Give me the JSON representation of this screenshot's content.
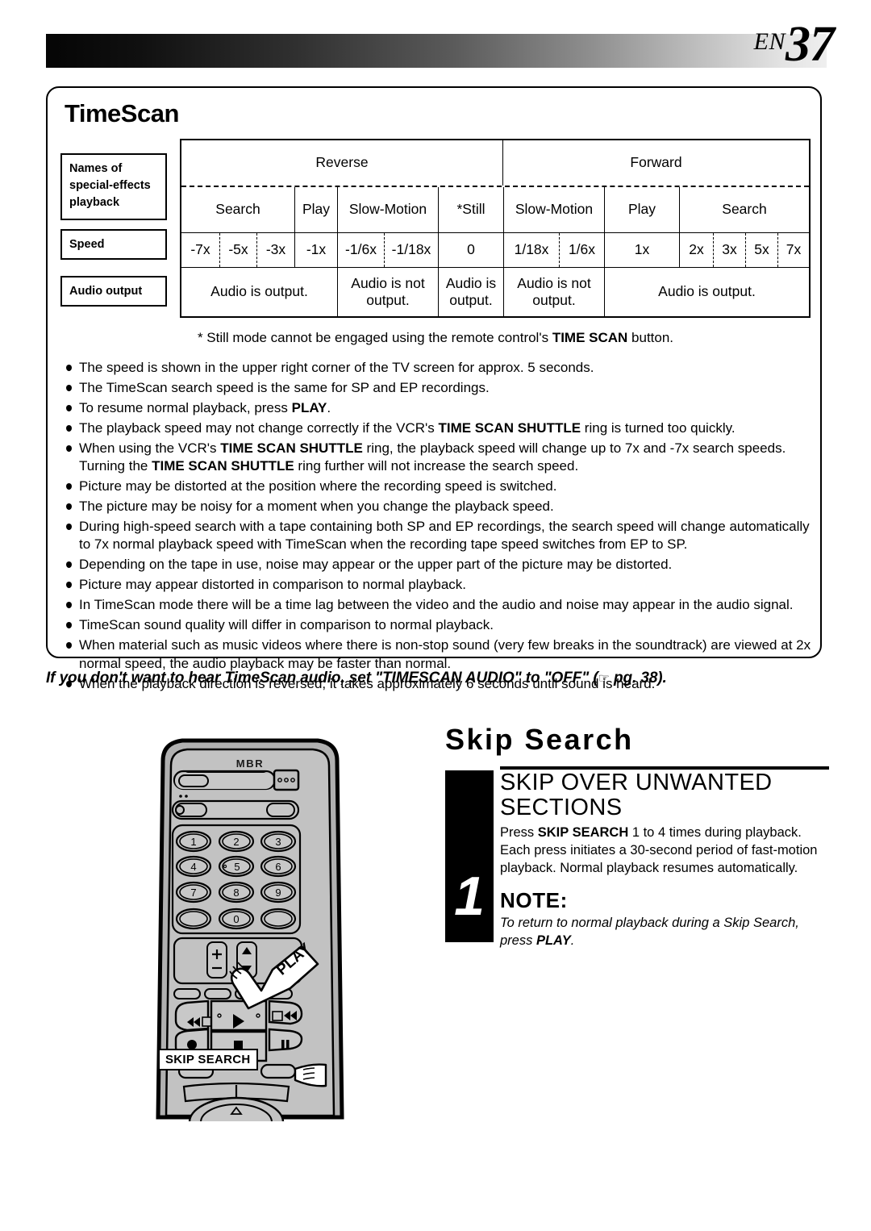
{
  "header": {
    "lang_code": "EN",
    "page_number": "37"
  },
  "panel": {
    "title": "TimeScan"
  },
  "table": {
    "row_labels": {
      "names": "Names of special-effects playback",
      "names_lines": [
        "Names of",
        "special-effects",
        "playback"
      ],
      "speed": "Speed",
      "audio": "Audio output"
    },
    "direction_headers": [
      "Reverse",
      "Forward"
    ],
    "mode_headers": [
      "Search",
      "Play",
      "Slow-Motion",
      "*Still",
      "Slow-Motion",
      "Play",
      "Search"
    ],
    "speeds": [
      "-7x",
      "-5x",
      "-3x",
      "-1x",
      "-1/6x",
      "-1/18x",
      "0",
      "1/18x",
      "1/6x",
      "1x",
      "2x",
      "3x",
      "5x",
      "7x"
    ],
    "audio_cells": [
      "Audio is output.",
      "Audio is not output.",
      "Audio is output.",
      "Audio is not output.",
      "Audio is output."
    ]
  },
  "footnote": {
    "prefix": "* Still mode cannot be engaged using the remote control's ",
    "bold": "TIME SCAN",
    "suffix": " button."
  },
  "bullets": [
    {
      "html": "The speed is shown in the upper right corner of the TV screen for approx. 5 seconds."
    },
    {
      "html": "The TimeScan search speed is the same for SP and EP recordings."
    },
    {
      "html": "To resume normal playback, press <b>PLAY</b>."
    },
    {
      "html": "The playback speed may not change correctly if the VCR's <b>TIME SCAN SHUTTLE</b> ring is turned too quickly."
    },
    {
      "html": "When using the VCR's <b>TIME SCAN SHUTTLE</b> ring, the playback speed will change up to 7x and -7x search speeds. Turning the <b>TIME SCAN SHUTTLE</b> ring further will not increase the search speed."
    },
    {
      "html": "Picture may be distorted at the position where the recording speed is switched."
    },
    {
      "html": "The picture may be noisy for a moment when you change the playback speed."
    },
    {
      "html": "During high-speed search with a tape containing both SP and EP recordings, the search speed will change automatically to 7x normal playback speed with TimeScan when the recording tape speed switches from EP to SP."
    },
    {
      "html": "Depending on the tape in use, noise may appear or the upper part of the picture may be distorted."
    },
    {
      "html": "Picture may appear distorted in comparison to normal playback."
    },
    {
      "html": "In TimeScan mode there will be a time lag between the video and the audio and noise may appear in the audio signal."
    },
    {
      "html": "TimeScan sound quality will differ in comparison to normal playback."
    },
    {
      "html": "When material such as music videos where there is non-stop sound (very few breaks in the soundtrack) are viewed at 2x normal speed, the audio playback may be faster than normal."
    },
    {
      "html": "When the playback direction is reversed, it takes approximately 6 seconds until sound is heard."
    }
  ],
  "caption": {
    "text_before": "If you don't want to hear TimeScan audio, set \"TIMESCAN AUDIO\" to \"OFF\" (",
    "hand_icon": "pointing-hand-icon",
    "page_ref": " pg. 38).",
    "full": "If you don't want to hear TimeScan audio, set \"TIMESCAN AUDIO\" to \"OFF\" (☞ pg. 38)."
  },
  "skip_search": {
    "title": "Skip Search",
    "step_number": "1",
    "heading": "SKIP OVER UNWANTED SECTIONS",
    "body_prefix": "Press ",
    "body_bold": "SKIP SEARCH",
    "body_suffix": " 1 to 4 times during playback. Each press initiates a 30-second period of fast-motion playback. Normal playback resumes automatically.",
    "note_title": "NOTE:",
    "note_prefix": "To return to normal playback during a Skip Search, press ",
    "note_bold": "PLAY",
    "note_suffix": "."
  },
  "remote": {
    "brand_logo": "MBR",
    "keypad": [
      "1",
      "2",
      "3",
      "4",
      "5",
      "6",
      "7",
      "8",
      "9",
      "0"
    ],
    "callouts": {
      "play": "PLAY",
      "skip_search": "SKIP SEARCH"
    },
    "transport_icons": [
      "rewind-icon",
      "play-icon",
      "fast-forward-icon",
      "record-icon",
      "stop-icon",
      "pause-icon"
    ],
    "volume_icons": [
      "plus-icon",
      "minus-icon",
      "channel-up-icon",
      "channel-down-icon"
    ]
  },
  "colors": {
    "ink": "#000000",
    "paper": "#ffffff",
    "remote_body": "#b3b3b3",
    "remote_face": "#bdbdbd"
  }
}
